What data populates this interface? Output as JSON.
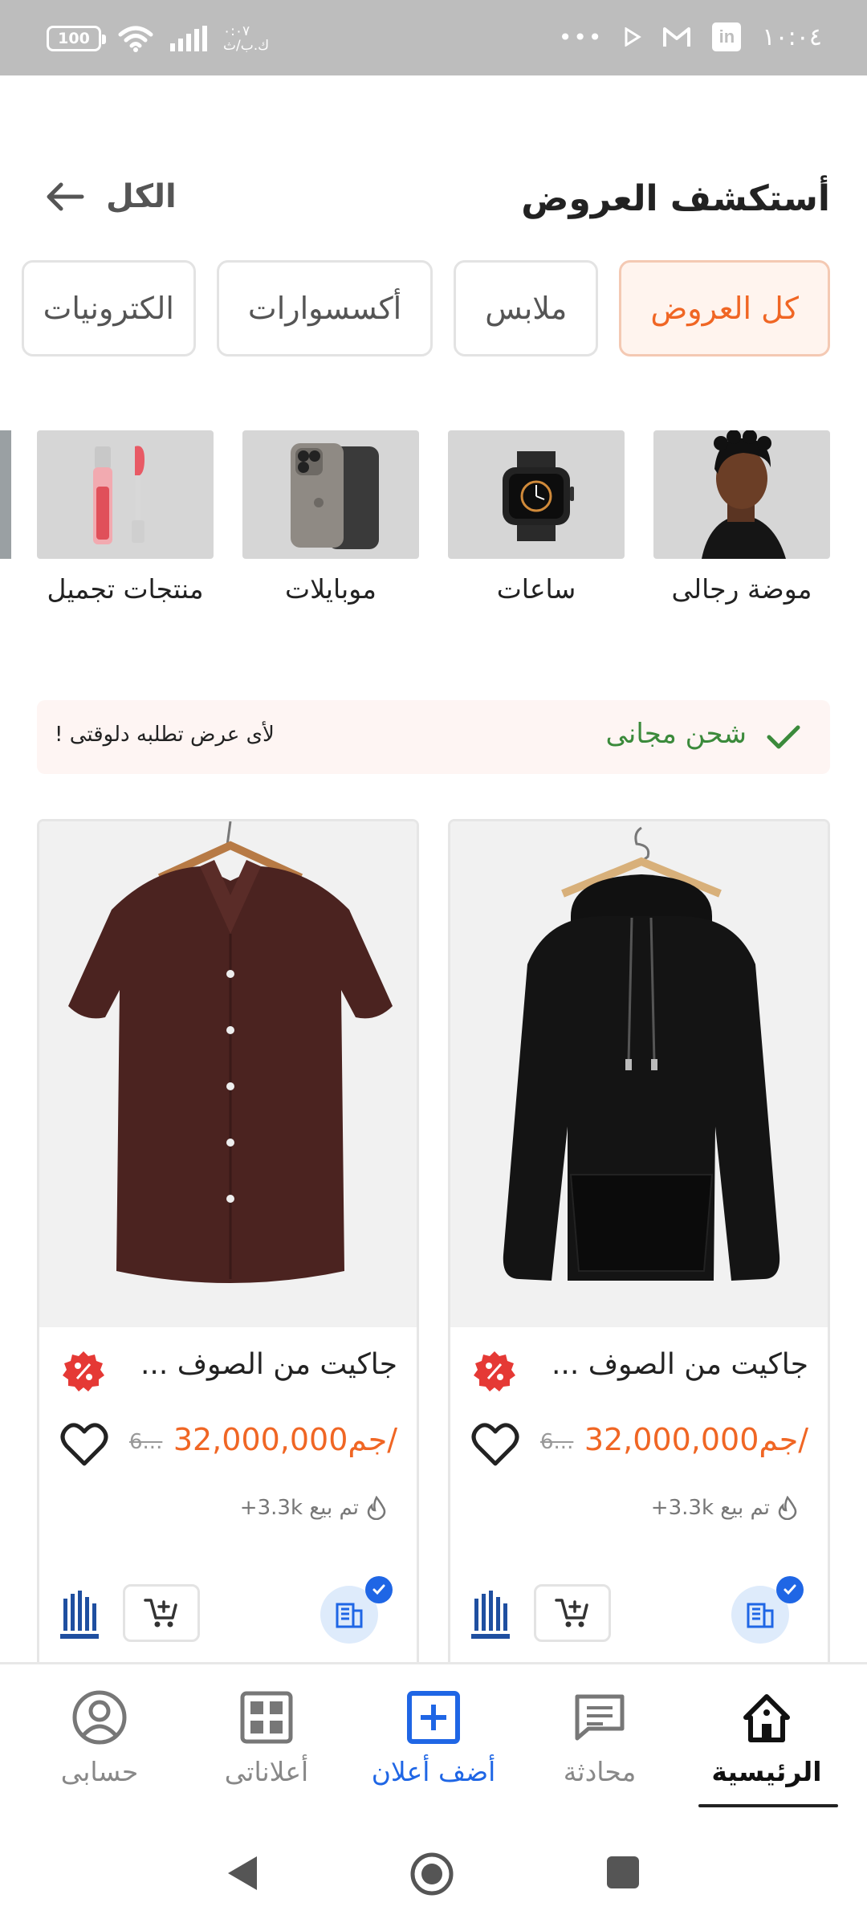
{
  "status_bar": {
    "battery": "100",
    "small_text_top": "٠:٠٧",
    "small_text_bottom": "ك.ب/ث",
    "dots": "•••",
    "linkedin": "in",
    "time": "١٠:٠٤"
  },
  "header": {
    "title": "أستكشف العروض",
    "see_all_label": "الكل"
  },
  "tabs": [
    {
      "label": "كل العروض",
      "active": true
    },
    {
      "label": "ملابس",
      "active": false
    },
    {
      "label": "أكسسوارات",
      "active": false
    },
    {
      "label": "الكترونيات",
      "active": false
    }
  ],
  "categories": [
    {
      "label": "موضة رجالى",
      "icon": "man-portrait"
    },
    {
      "label": "ساعات",
      "icon": "smartwatch"
    },
    {
      "label": "موبايلات",
      "icon": "smartphone"
    },
    {
      "label": "منتجات تجميل",
      "icon": "lip-gloss"
    }
  ],
  "shipping_banner": {
    "title": "شحن مجانى",
    "subtitle": "لأى عرض تطلبه دلوقتى !"
  },
  "products": [
    {
      "title": "جاكيت من الصوف ...",
      "price": "32,000,000جم/",
      "old_price": "6...",
      "sold": "تم بيع 3.3k+",
      "image": "black-hoodie"
    },
    {
      "title": "جاكيت من الصوف ...",
      "price": "32,000,000جم/",
      "old_price": "6...",
      "sold": "تم بيع 3.3k+",
      "image": "brown-shirt"
    }
  ],
  "bottom_nav": [
    {
      "label": "الرئيسية",
      "icon": "home-icon",
      "active": true
    },
    {
      "label": "محادثة",
      "icon": "chat-icon",
      "active": false
    },
    {
      "label": "أضف أعلان",
      "icon": "add-icon",
      "active": false
    },
    {
      "label": "أعلاناتى",
      "icon": "grid-icon",
      "active": false
    },
    {
      "label": "حسابى",
      "icon": "account-icon",
      "active": false
    }
  ],
  "colors": {
    "accent": "#f06624",
    "brand_blue": "#1f66e5",
    "success": "#3b8a3b"
  }
}
